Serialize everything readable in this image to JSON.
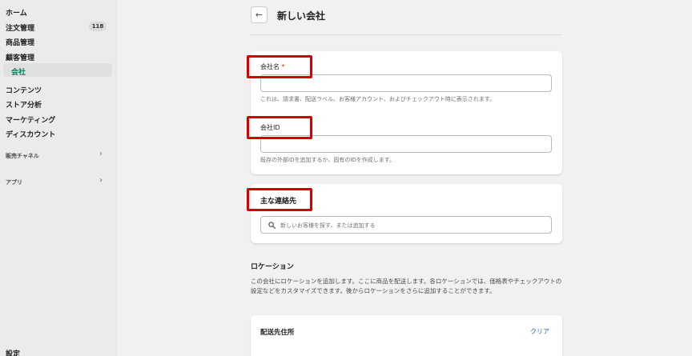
{
  "sidebar": {
    "items": [
      {
        "label": "ホーム"
      },
      {
        "label": "注文管理",
        "badge": "118"
      },
      {
        "label": "商品管理"
      },
      {
        "label": "顧客管理"
      },
      {
        "label": "会社"
      },
      {
        "label": "コンテンツ"
      },
      {
        "label": "ストア分析"
      },
      {
        "label": "マーケティング"
      },
      {
        "label": "ディスカウント"
      }
    ],
    "sections": [
      {
        "label": "販売チャネル"
      },
      {
        "label": "アプリ"
      }
    ],
    "settings_label": "設定"
  },
  "header": {
    "back_icon": "←",
    "title": "新しい会社"
  },
  "company_card": {
    "name_label": "会社名",
    "name_required_mark": "*",
    "name_value": "",
    "name_help": "これは、請求書、配送ラベル、お客様アカウント、およびチェックアウト時に表示されます。",
    "id_label": "会社ID",
    "id_value": "",
    "id_help": "既存の外部IDを追加するか、固有のIDを作成します。"
  },
  "contact_card": {
    "title": "主な連絡先",
    "search_placeholder": "新しいお客様を探す、または追加する"
  },
  "location": {
    "title": "ロケーション",
    "description": "この会社にロケーションを追加します。ここに商品を配送します。各ロケーションでは、価格表やチェックアウトの設定などをカスタマイズできます。後からロケーションをさらに追加することができます。",
    "shipping_card_title": "配送先住所",
    "clear_label": "クリア"
  },
  "colors": {
    "accent_green": "#047b5d",
    "annotation_red": "#d70000",
    "link_blue": "#2c6ecb"
  }
}
